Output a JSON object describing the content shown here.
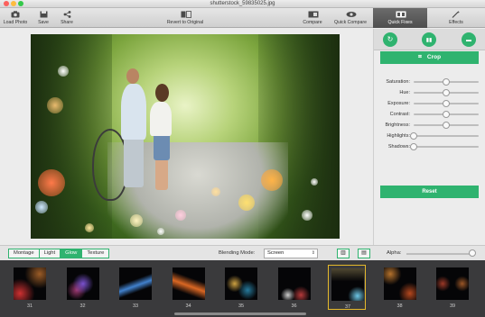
{
  "window": {
    "title": "shutterstock_59835025.jpg"
  },
  "toolbar": {
    "load_photo": "Load Photo",
    "save": "Save",
    "share": "Share",
    "revert": "Revert to Original",
    "compare": "Compare",
    "quick_compare": "Quick Compare",
    "quick_fixes": "Quick Fixes",
    "effects": "Effects"
  },
  "panel": {
    "crop_label": "Crop",
    "sliders": [
      {
        "label": "Saturation:",
        "value": 0.5
      },
      {
        "label": "Hue:",
        "value": 0.5
      },
      {
        "label": "Exposure:",
        "value": 0.5
      },
      {
        "label": "Contrast:",
        "value": 0.5
      },
      {
        "label": "Brightness:",
        "value": 0.5
      },
      {
        "label": "Highlights:",
        "value": 0.0
      },
      {
        "label": "Shadows:",
        "value": 0.0
      }
    ],
    "reset_label": "Reset"
  },
  "options": {
    "tabs": [
      {
        "label": "Montage",
        "active": false
      },
      {
        "label": "Light",
        "active": false
      },
      {
        "label": "Glow",
        "active": true
      },
      {
        "label": "Texture",
        "active": false
      }
    ],
    "blending_label": "Blending Mode:",
    "blending_value": "Screen",
    "alpha_label": "Alpha:",
    "alpha_value": 1.0
  },
  "filmstrip": {
    "items": [
      {
        "num": "31",
        "selected": false
      },
      {
        "num": "32",
        "selected": false
      },
      {
        "num": "33",
        "selected": false
      },
      {
        "num": "34",
        "selected": false
      },
      {
        "num": "35",
        "selected": false
      },
      {
        "num": "36",
        "selected": false
      },
      {
        "num": "37",
        "selected": true
      },
      {
        "num": "38",
        "selected": false
      },
      {
        "num": "39",
        "selected": false
      }
    ]
  },
  "colors": {
    "accent": "#2fb36f",
    "selected_border": "#e5b92b"
  },
  "icons": {
    "load_photo": "camera-icon",
    "save": "save-icon",
    "share": "share-icon",
    "revert": "revert-icon",
    "compare": "compare-icon",
    "quick_compare": "eye-icon",
    "quick_fixes": "quick-fixes-icon",
    "effects": "magic-wand-icon"
  }
}
